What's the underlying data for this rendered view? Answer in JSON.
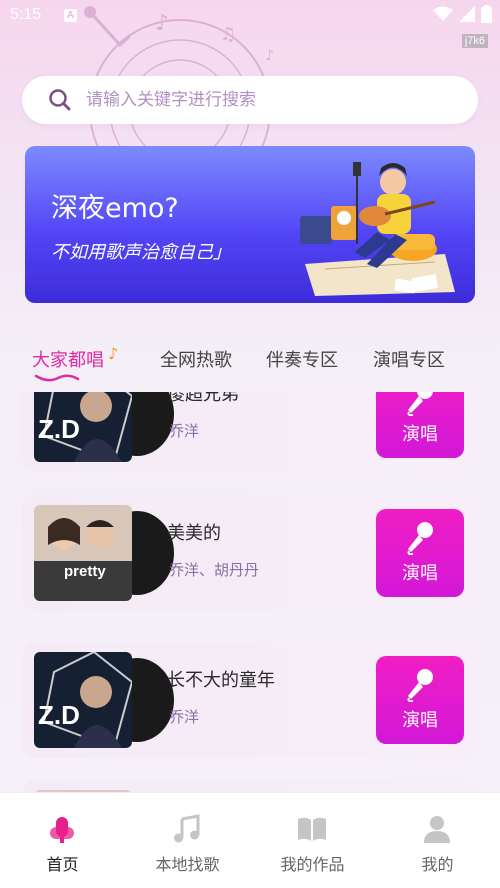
{
  "status": {
    "time": "5:15",
    "a_badge": "A",
    "tag": "j7k6"
  },
  "search": {
    "placeholder": "请输入关键字进行搜索",
    "value": ""
  },
  "banner": {
    "title": "深夜emo?",
    "subtitle": "不如用歌声治愈自己」"
  },
  "tabs": [
    {
      "label": "大家都唱",
      "active": true
    },
    {
      "label": "全网热歌",
      "active": false
    },
    {
      "label": "伴奏专区",
      "active": false
    },
    {
      "label": "演唱专区",
      "active": false
    }
  ],
  "songs": [
    {
      "name": "傻超兄弟",
      "artist": "乔洋",
      "button": "演唱"
    },
    {
      "name": "美美的",
      "artist": "乔洋、胡丹丹",
      "button": "演唱",
      "cover_text": "pretty"
    },
    {
      "name": "长不大的童年",
      "artist": "乔洋",
      "button": "演唱"
    }
  ],
  "nav": [
    {
      "label": "首页",
      "icon": "mic-icon",
      "active": true
    },
    {
      "label": "本地找歌",
      "icon": "music-note-icon",
      "active": false
    },
    {
      "label": "我的作品",
      "icon": "book-icon",
      "active": false
    },
    {
      "label": "我的",
      "icon": "user-icon",
      "active": false
    }
  ],
  "colors": {
    "accent": "#e02aa6",
    "button": "#f01ec4",
    "banner_start": "#7d8bff",
    "banner_end": "#3d2bd9"
  }
}
